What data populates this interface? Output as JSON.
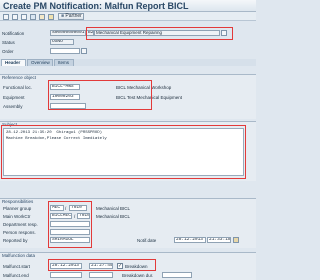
{
  "title": "Create PM Notification: Malfun Report BICL",
  "toolbar": {
    "partner_label": "Partner"
  },
  "header": {
    "notification_label": "Notification",
    "notification_value": "%00000000001",
    "notification_type": "B2",
    "notification_desc": "Mechanical Equipment Repairing",
    "status_label": "Status",
    "status_value": "OSNO",
    "order_label": "Order"
  },
  "tabs": [
    "Header",
    "Overview",
    "Items"
  ],
  "reference": {
    "section_title": "Reference object",
    "funcloc_label": "Functional loc.",
    "funcloc_value": "BICL-MWS",
    "funcloc_desc": "BICL Mechanical Workshop",
    "equipment_label": "Equipment",
    "equipment_value": "10000203",
    "equipment_desc": "BICL Test Mechanical Equipment",
    "assembly_label": "Assembly"
  },
  "subject": {
    "section_title": "Subject",
    "line1": "28.12.2013 21:35:20  Ghiragu1 (PRSSPROD)",
    "line2": "Machine Breakdon,Please Correct Imediately"
  },
  "responsibilities": {
    "section_title": "Responsibilities",
    "planner_label": "Planner group",
    "planner_value": "MEC",
    "planner_plant": "7010",
    "planner_desc": "Mechanical BICL",
    "workctr_label": "Main WorkCtr",
    "workctr_value": "BICLMECH",
    "workctr_plant": "7010",
    "workctr_desc": "Mechanical BICL",
    "dept_label": "Department resp.",
    "person_label": "Person respons.",
    "reported_label": "Reported by",
    "reported_value": "SHIRAGUL",
    "notif_date_label": "Notif.date",
    "notif_date": "28.12.2013",
    "notif_time": "21:33:18"
  },
  "malfunction": {
    "section_title": "Malfunction data",
    "start_label": "Malfunct.start",
    "start_date": "28.12.2013",
    "start_time": "21:27:45",
    "breakdown_label": "Breakdown",
    "end_label": "Malfunct.end",
    "duration_label": "Breakdown dur."
  }
}
